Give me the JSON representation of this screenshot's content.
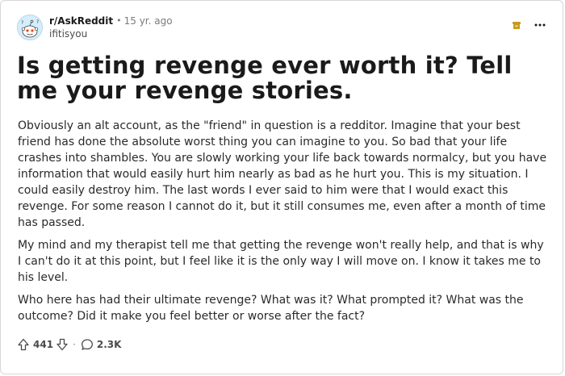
{
  "post": {
    "subreddit": "r/AskReddit",
    "separator": "•",
    "age": "15 yr. ago",
    "author": "ifitisyou",
    "title": "Is getting revenge ever worth it? Tell me your revenge stories.",
    "paragraphs": [
      "Obviously an alt account, as the \"friend\" in question is a redditor. Imagine that your best friend has done the absolute worst thing you can imagine to you. So bad that your life crashes into shambles. You are slowly working your life back towards normalcy, but you have information that would easily hurt him nearly as bad as he hurt you. This is my situation. I could easily destroy him. The last words I ever said to him were that I would exact this revenge. For some reason I cannot do it, but it still consumes me, even after a month of time has passed.",
      "My mind and my therapist tell me that getting the revenge won't really help, and that is why I can't do it at this point, but I feel like it is the only way I will move on. I know it takes me to his level.",
      "Who here has had their ultimate revenge? What was it? What prompted it? What was the outcome? Did it make you feel better or worse after the fact?"
    ]
  },
  "footer": {
    "votes": "441",
    "separator": "·",
    "comments": "2.3K"
  },
  "icons": {
    "avatar": "reddit-snoo-icon",
    "archive": "archive-icon",
    "more": "more-options-icon",
    "upvote": "upvote-arrow-icon",
    "downvote": "downvote-arrow-icon",
    "comments": "comment-bubble-icon"
  },
  "colors": {
    "archive": "#c79a1a",
    "text": "#1a1a1b",
    "muted": "#787c7e",
    "avatar_bg": "#d4eefc"
  }
}
